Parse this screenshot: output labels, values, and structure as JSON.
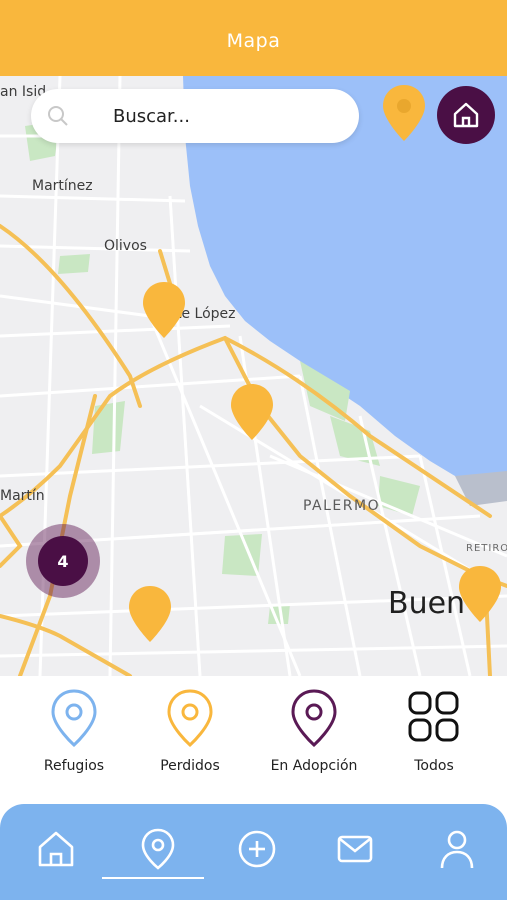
{
  "header": {
    "title": "Mapa"
  },
  "search": {
    "placeholder": "Buscar..."
  },
  "map": {
    "labels": {
      "san_isidro": "an Isid",
      "martinez": "Martínez",
      "olivos": "Olivos",
      "vicente_lopez": "te López",
      "san_martin": "Martín",
      "palermo": "PALERMO",
      "retiro": "RETIRO",
      "buenos_aires": "Buen"
    },
    "cluster_count": "4",
    "colors": {
      "water": "#9cc0f9",
      "land": "#efeff1",
      "park": "#c9e7c3",
      "highway": "#f5c056",
      "pin": "#f9b73d"
    }
  },
  "filters": [
    {
      "label": "Refugios",
      "icon": "location-pin-icon",
      "color": "#7db3ee"
    },
    {
      "label": "Perdidos",
      "icon": "location-pin-icon",
      "color": "#f9b73d"
    },
    {
      "label": "En Adopción",
      "icon": "location-pin-icon",
      "color": "#5a1a55"
    },
    {
      "label": "Todos",
      "icon": "grid-icon",
      "color": "#111111"
    }
  ],
  "nav": {
    "items": [
      "home-icon",
      "location-pin-icon",
      "plus-circle-icon",
      "mail-icon",
      "user-icon"
    ],
    "active": "location-pin-icon"
  },
  "theme": {
    "primary": "#f9b73d",
    "accent": "#4a0f45",
    "nav": "#7db3ee"
  }
}
